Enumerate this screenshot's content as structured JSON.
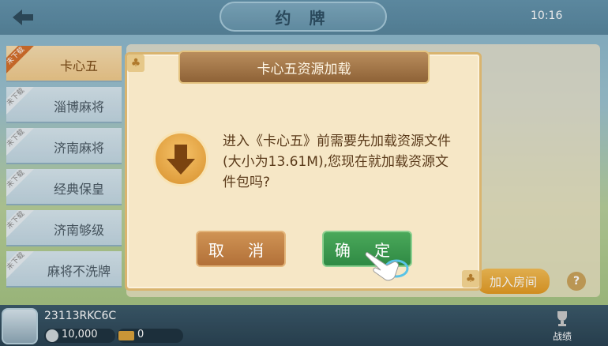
{
  "header": {
    "title": "约 牌",
    "time": "10:16"
  },
  "sidebar": {
    "ribbon": "未下载",
    "items": [
      {
        "label": "卡心五"
      },
      {
        "label": "淄博麻将"
      },
      {
        "label": "济南麻将"
      },
      {
        "label": "经典保皇"
      },
      {
        "label": "济南够级"
      },
      {
        "label": "麻将不洗牌"
      }
    ]
  },
  "panel": {
    "join_label": "加入房间",
    "help_label": "?"
  },
  "player": {
    "id": "23113RKC6C",
    "coins": "10,000",
    "cards": "0",
    "record_label": "战绩"
  },
  "dialog": {
    "title": "卡心五资源加载",
    "message": "进入《卡心五》前需要先加载资源文件(大小为13.61M),您现在就加载资源文件包吗?",
    "cancel_label": "取 消",
    "ok_label": "确 定"
  },
  "colors": {
    "accent": "#d46f2c",
    "ok": "#2f8a44",
    "cancel": "#b27038",
    "dialog_bg": "#f6e7c6"
  },
  "icons": {
    "back": "arrow-left-icon",
    "download": "download-arrow-icon",
    "club": "club-suit-icon",
    "trophy": "trophy-icon",
    "pointer": "pointing-hand-icon"
  }
}
